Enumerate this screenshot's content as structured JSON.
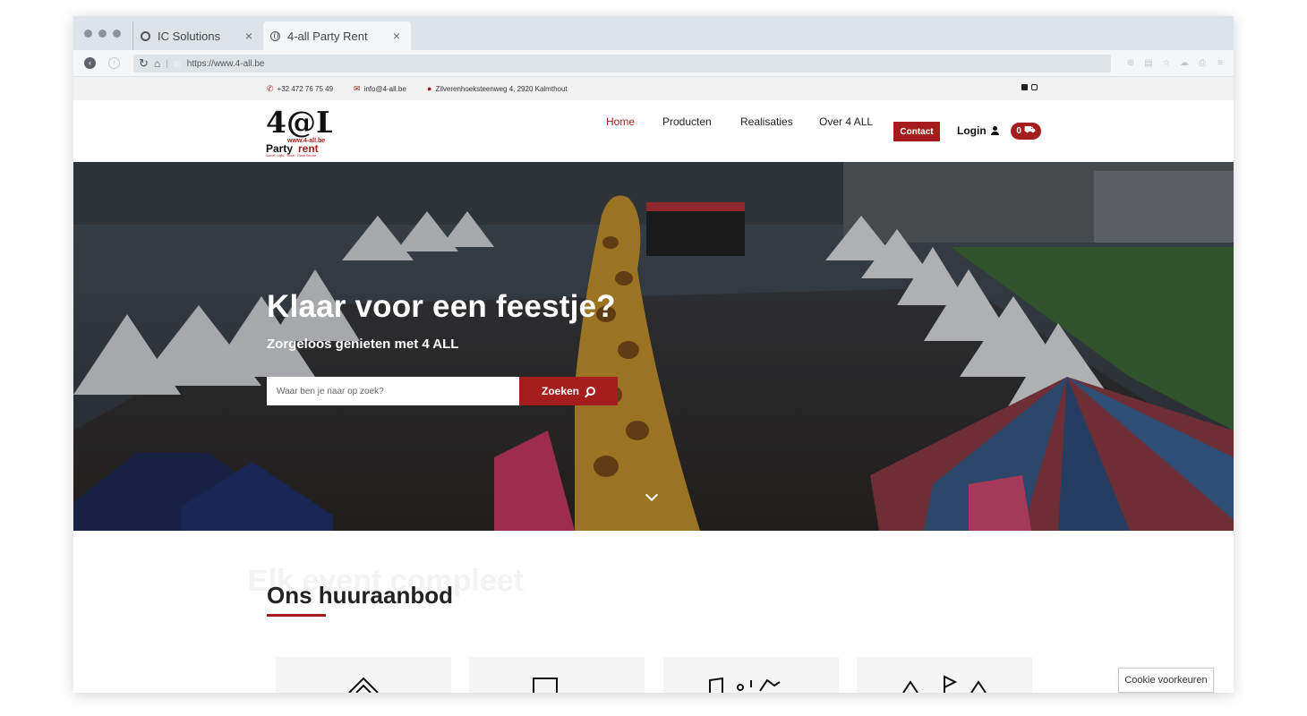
{
  "browser": {
    "tabs": [
      {
        "title": "IC Solutions",
        "icon": "circle-icon"
      },
      {
        "title": "4-all Party Rent",
        "icon": "globe-icon",
        "active": true
      }
    ],
    "tab_close": "×",
    "url": "https://www.4-all.be"
  },
  "topbar": {
    "phone": "+32 472 76 75 49",
    "email": "info@4-all.be",
    "address": "Zilverenhoeksteenweg 4, 2920 Kalmthout"
  },
  "nav": {
    "items": [
      "Home",
      "Producten",
      "Realisaties",
      "Over 4 ALL"
    ],
    "active": "Home",
    "contact": "Contact",
    "login": "Login",
    "cart_count": "0"
  },
  "logo": {
    "main": "4@LL",
    "url": "www.4-all.be",
    "party": "Party",
    "rent": "rent",
    "tagline": "Sound · Light · Vision · Event Service"
  },
  "hero": {
    "title": "Klaar voor een feestje?",
    "subtitle": "Zorgeloos genieten met 4 ALL",
    "search_placeholder": "Waar ben je naar op zoek?",
    "search_button": "Zoeken"
  },
  "offer": {
    "ghost_text": "Elk event compleet",
    "title": "Ons huuraanbod"
  },
  "cookie": "Cookie voorkeuren",
  "colors": {
    "brand": "#a51d1d",
    "topbar_bg": "#f2f2f2",
    "tabbar_bg": "#dde3e9"
  }
}
